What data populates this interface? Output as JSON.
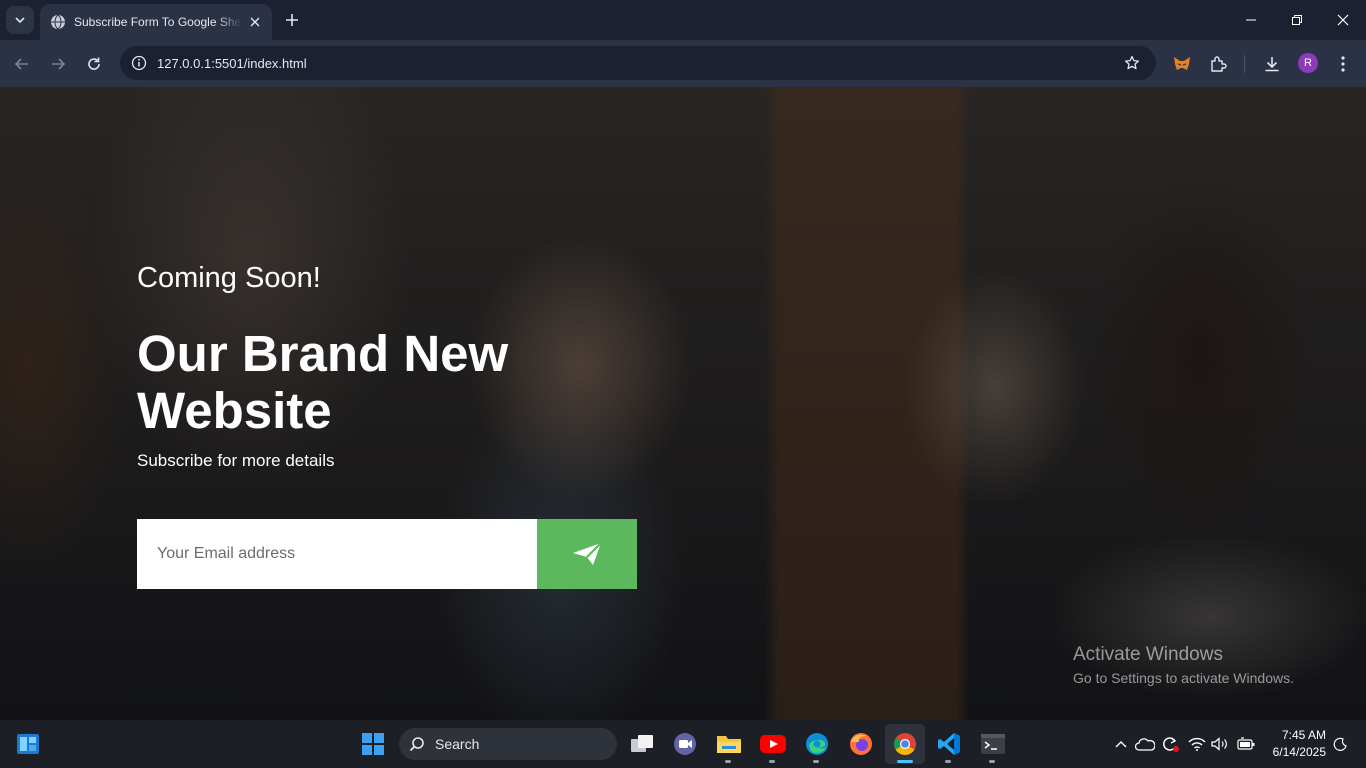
{
  "browser": {
    "tab": {
      "title": "Subscribe Form To Google Sheet",
      "favicon": "globe-icon"
    },
    "address": {
      "url": "127.0.0.1:5501/index.html"
    },
    "profile_initial": "R",
    "colors": {
      "frame": "#1b2130",
      "toolbar": "#2b3245"
    }
  },
  "page": {
    "kicker": "Coming Soon!",
    "title": "Our Brand New Website",
    "subtitle": "Subscribe for more details",
    "form": {
      "email_placeholder": "Your Email address",
      "submit_icon": "paper-plane-icon"
    },
    "accent": "#5cb85c"
  },
  "watermark": {
    "title": "Activate Windows",
    "subtitle": "Go to Settings to activate Windows."
  },
  "taskbar": {
    "search_label": "Search",
    "apps": [
      "start-icon",
      "task-view-icon",
      "meet-icon",
      "file-explorer-icon",
      "youtube-icon",
      "edge-icon",
      "firefox-icon",
      "chrome-icon",
      "vscode-icon",
      "terminal-icon"
    ],
    "clock": {
      "time": "7:45 AM",
      "date": "6/14/2025"
    }
  }
}
